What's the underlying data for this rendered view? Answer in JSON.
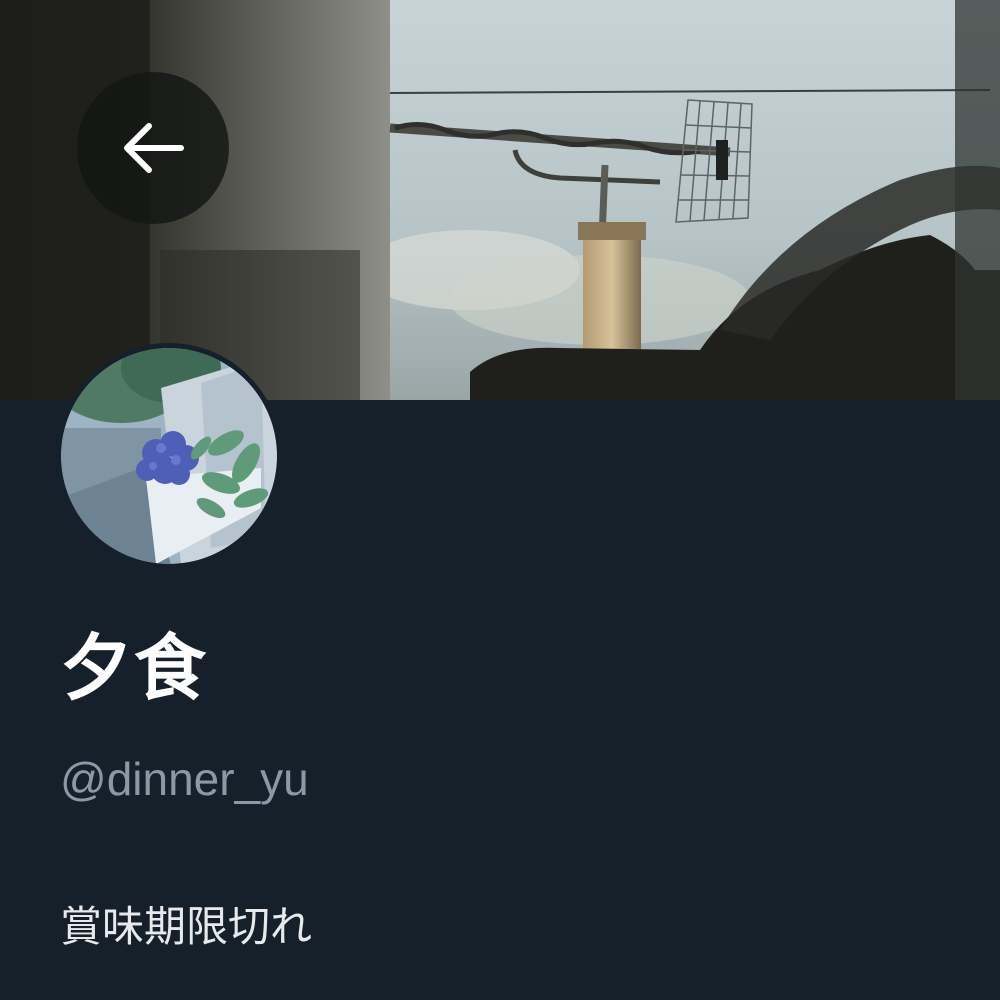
{
  "profile": {
    "display_name": "夕食",
    "handle": "@dinner_yu",
    "bio": "賞味期限切れ"
  },
  "header": {
    "back_icon": "arrow-left-icon"
  },
  "theme": {
    "background": "#15202b",
    "name_color": "#ffffff",
    "handle_color": "#8b98a5",
    "bio_color": "#e7e9ea"
  }
}
